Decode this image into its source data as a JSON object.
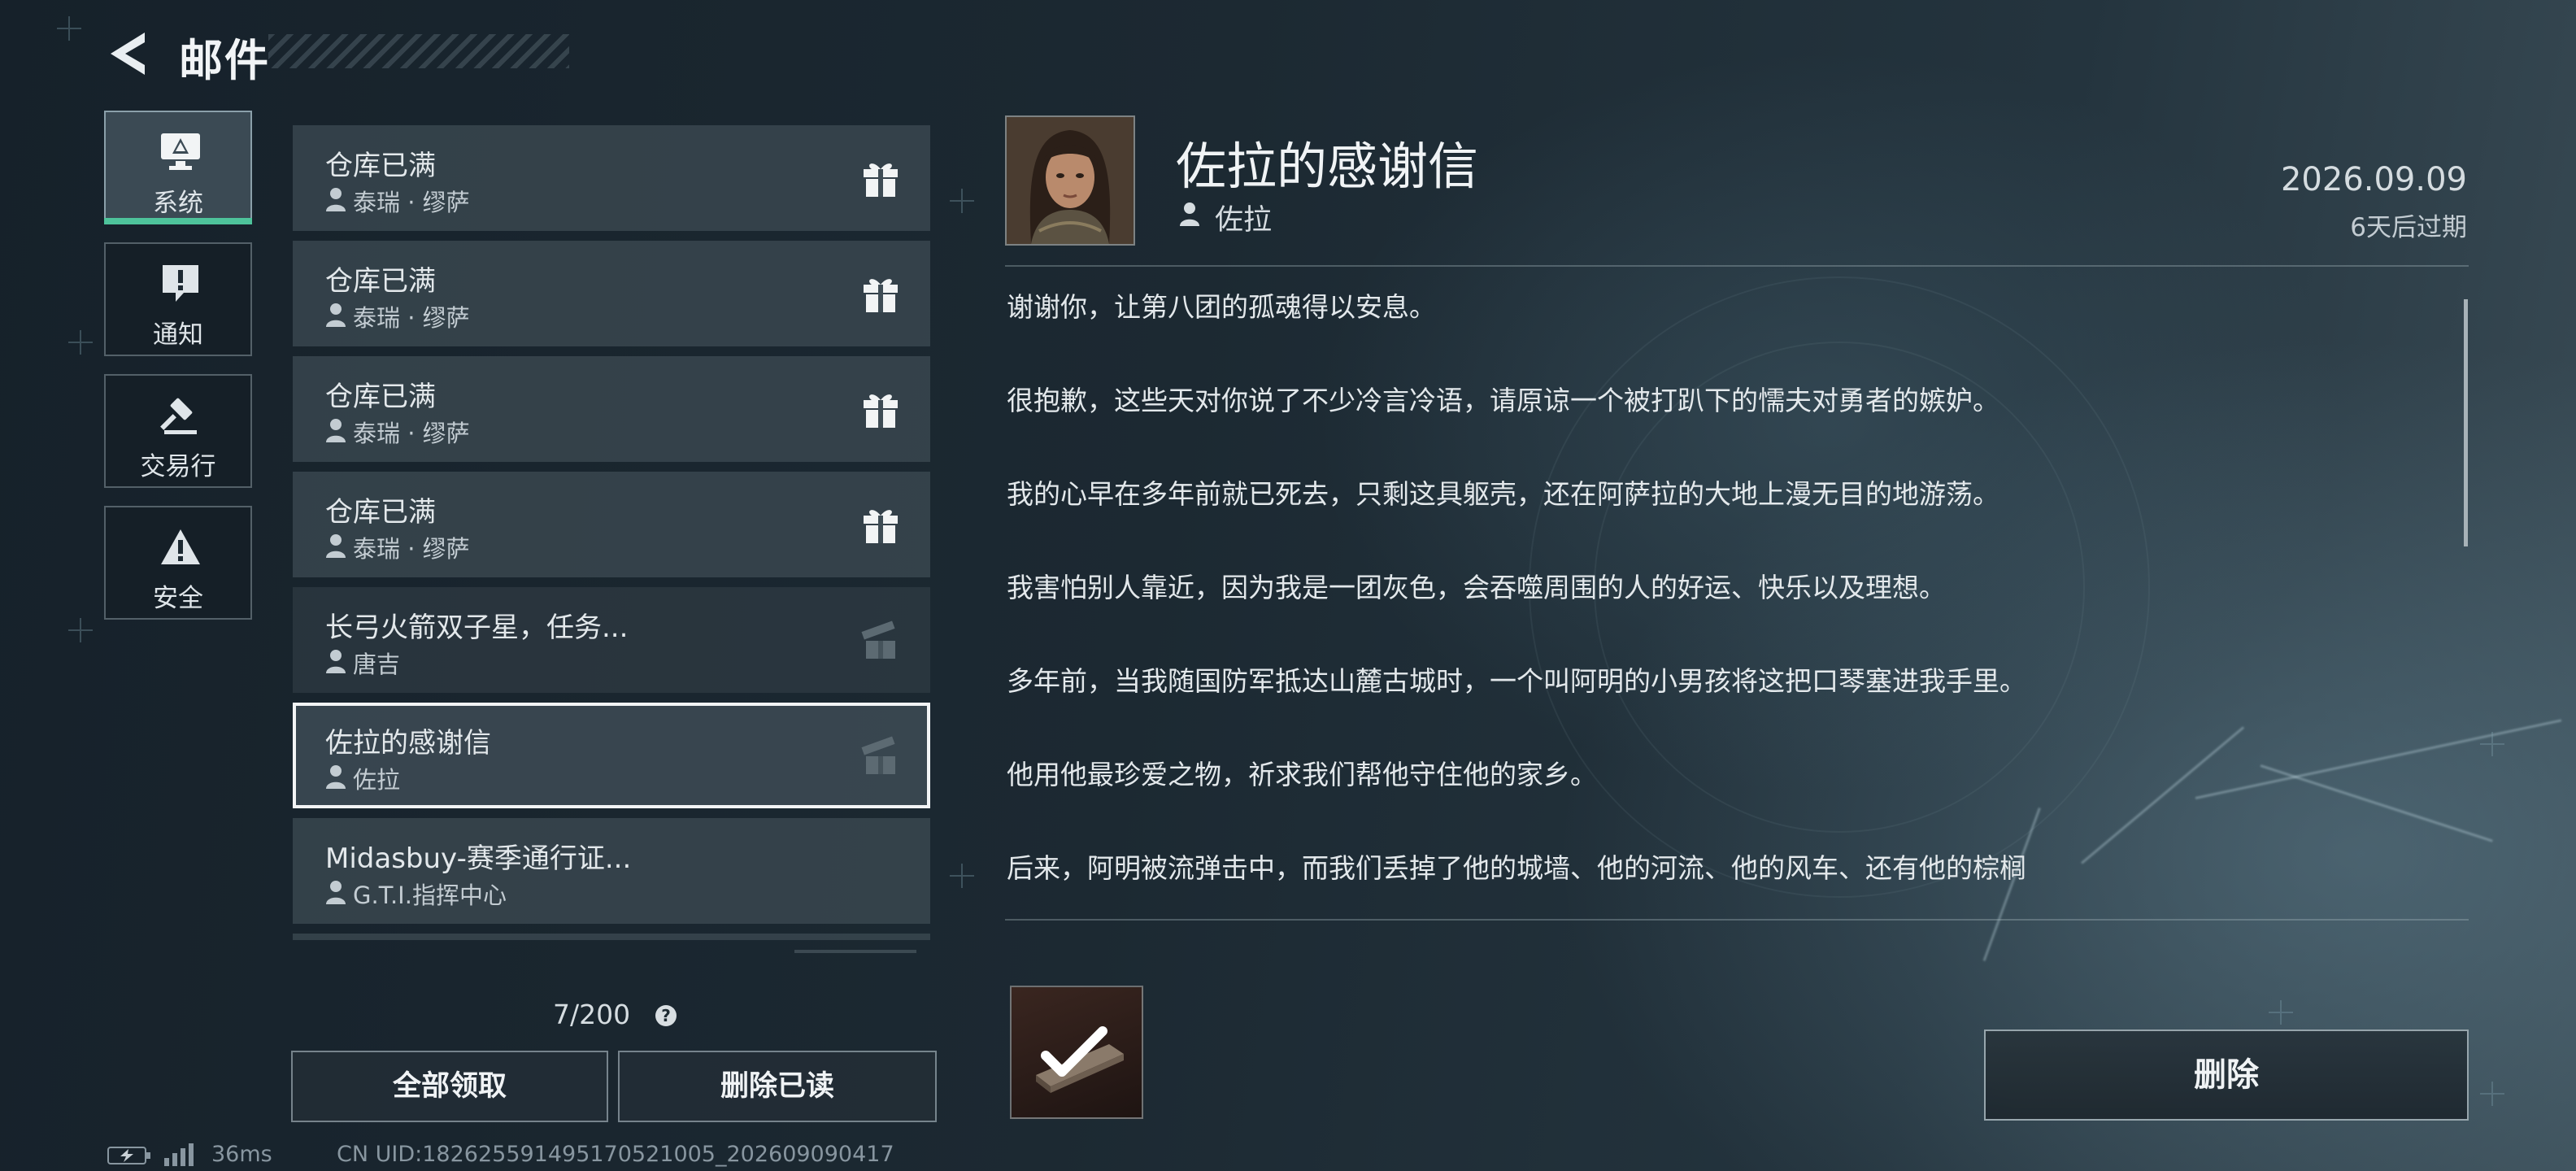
{
  "header": {
    "title": "邮件",
    "back_icon": "back-arrow-icon"
  },
  "categories": [
    {
      "label": "系统",
      "icon": "monitor-alert-icon",
      "active": true
    },
    {
      "label": "通知",
      "icon": "exclamation-bubble-icon",
      "active": false
    },
    {
      "label": "交易行",
      "icon": "gavel-icon",
      "active": false
    },
    {
      "label": "安全",
      "icon": "warning-triangle-icon",
      "active": false
    }
  ],
  "mails": [
    {
      "subject": "仓库已满",
      "sender": "泰瑞 · 缪萨",
      "reward_icon": "gift-icon",
      "reward_claimed": false
    },
    {
      "subject": "仓库已满",
      "sender": "泰瑞 · 缪萨",
      "reward_icon": "gift-icon",
      "reward_claimed": false
    },
    {
      "subject": "仓库已满",
      "sender": "泰瑞 · 缪萨",
      "reward_icon": "gift-icon",
      "reward_claimed": false
    },
    {
      "subject": "仓库已满",
      "sender": "泰瑞 · 缪萨",
      "reward_icon": "gift-icon",
      "reward_claimed": false
    },
    {
      "subject": "长弓火箭双子星，任务...",
      "sender": "唐吉",
      "reward_icon": "gift-icon",
      "reward_claimed": true
    },
    {
      "subject": "佐拉的感谢信",
      "sender": "佐拉",
      "reward_icon": "gift-icon",
      "reward_claimed": true,
      "selected": true
    },
    {
      "subject": "Midasbuy-赛季通行证...",
      "sender": "G.T.I.指挥中心"
    }
  ],
  "counter": "7/200",
  "help_icon": "?",
  "buttons": {
    "claim_all": "全部领取",
    "delete_read": "删除已读",
    "delete": "删除"
  },
  "status": {
    "ping": "36ms",
    "uid": "CN UID:18262559149517052100​5_202609090417"
  },
  "detail": {
    "title": "佐拉的感谢信",
    "sender": "佐拉",
    "date": "2026.09.09",
    "expire": "6天后过期",
    "paragraphs": [
      "谢谢你，让第八团的孤魂得以安息。",
      "很抱歉，这些天对你说了不少冷言冷语，请原谅一个被打趴下的懦夫对勇者的嫉妒。",
      "我的心早在多年前就已死去，只剩这具躯壳，还在阿萨拉的大地上漫无目的地游荡。",
      "我害怕别人靠近，因为我是一团灰色，会吞噬周围的人的好运、快乐以及理想。",
      "多年前，当我随国防军抵达山麓古城时，一个叫阿明的小男孩将这把口琴塞进我手里。",
      "他用他最珍爱之物，祈求我们帮他守住他的家乡。",
      "后来，阿明被流弹击中，而我们丢掉了他的城墙、他的河流、他的风车、还有他的棕榈"
    ],
    "attachment_icon": "harmonica-claimed-icon"
  }
}
